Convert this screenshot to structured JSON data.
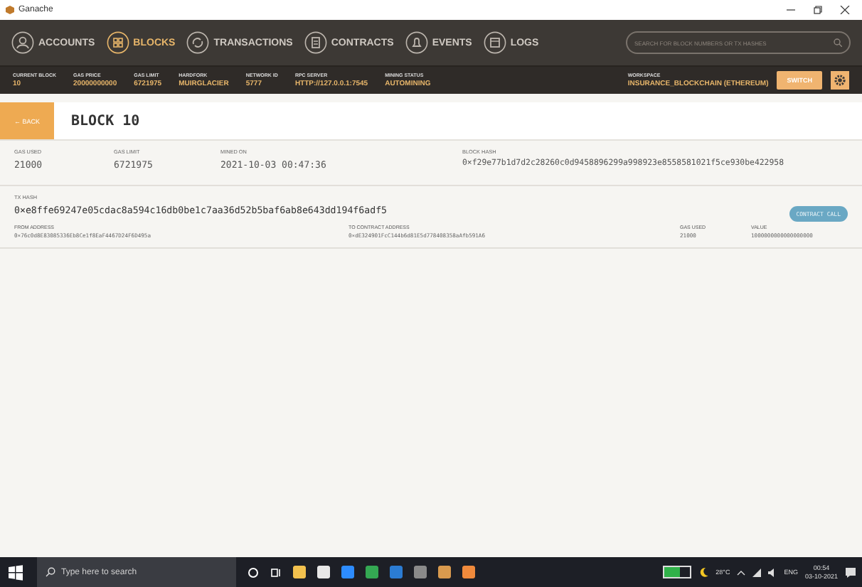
{
  "window": {
    "title": "Ganache"
  },
  "nav": {
    "tabs": [
      {
        "label": "ACCOUNTS",
        "selected": false
      },
      {
        "label": "BLOCKS",
        "selected": true
      },
      {
        "label": "TRANSACTIONS",
        "selected": false
      },
      {
        "label": "CONTRACTS",
        "selected": false
      },
      {
        "label": "EVENTS",
        "selected": false
      },
      {
        "label": "LOGS",
        "selected": false
      }
    ],
    "search": {
      "placeholder": "SEARCH FOR BLOCK NUMBERS OR TX HASHES"
    }
  },
  "stats": [
    {
      "label": "CURRENT BLOCK",
      "value": "10"
    },
    {
      "label": "GAS PRICE",
      "value": "20000000000"
    },
    {
      "label": "GAS LIMIT",
      "value": "6721975"
    },
    {
      "label": "HARDFORK",
      "value": "MUIRGLACIER"
    },
    {
      "label": "NETWORK ID",
      "value": "5777"
    },
    {
      "label": "RPC SERVER",
      "value": "HTTP://127.0.0.1:7545"
    },
    {
      "label": "MINING STATUS",
      "value": "AUTOMINING"
    }
  ],
  "workspace": {
    "label": "WORKSPACE",
    "value": "INSURANCE_BLOCKCHAIN (ETHEREUM)"
  },
  "switch_button": "SWITCH",
  "block": {
    "back": "← BACK",
    "title": "BLOCK 10",
    "info": [
      {
        "label": "GAS USED",
        "value": "21000"
      },
      {
        "label": "GAS LIMIT",
        "value": "6721975"
      },
      {
        "label": "MINED ON",
        "value": "2021-10-03 00:47:36"
      },
      {
        "label": "BLOCK HASH",
        "value": "0×f29e77b1d7d2c28260c0d9458896299a998923e8558581021f5ce930be422958"
      }
    ]
  },
  "transaction": {
    "hash_label": "TX HASH",
    "hash": "0×e8ffe69247e05cdac8a594c16db0be1c7aa36d52b5baf6ab8e643dd194f6adf5",
    "type": "CONTRACT CALL",
    "fields": [
      {
        "label": "FROM ADDRESS",
        "value": "0×76c0d8E83085336Eb8Ce1f8EaF4467D24F6D495a"
      },
      {
        "label": "TO CONTRACT ADDRESS",
        "value": "0×dE324901FcC144b6d81E5d778408358aAfb591A6"
      },
      {
        "label": "GAS USED",
        "value": "21000"
      },
      {
        "label": "VALUE",
        "value": "1000000000000000000"
      }
    ]
  },
  "taskbar": {
    "search": {
      "placeholder": "Type here to search"
    },
    "battery": {
      "level": 0.6
    },
    "weather": "28°C",
    "language": "ENG",
    "time": "00:54",
    "date": "03-10-2021"
  }
}
